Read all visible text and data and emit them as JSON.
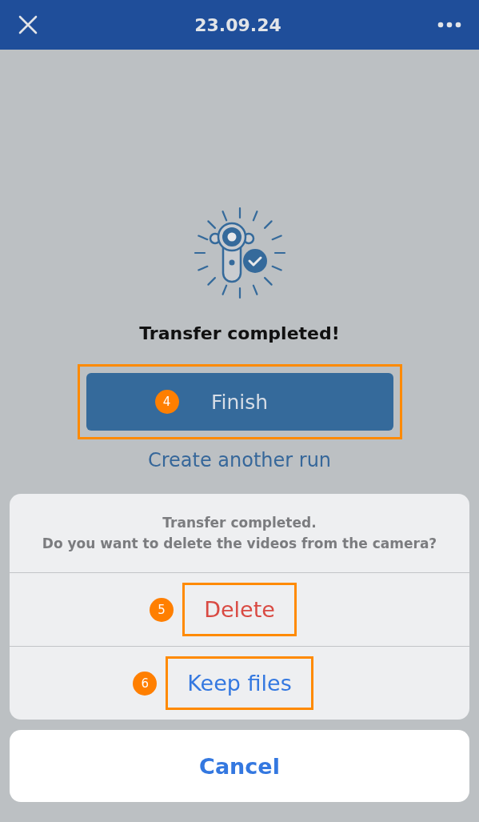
{
  "header": {
    "title": "23.09.24"
  },
  "status": {
    "title": "Transfer completed!"
  },
  "primary_button": {
    "label": "Finish",
    "callout": "4"
  },
  "link": {
    "label": "Create another run"
  },
  "action_sheet": {
    "message": [
      "Transfer completed.",
      "Do you want to delete the videos from the camera?"
    ],
    "actions": [
      {
        "label": "Delete",
        "kind": "destructive",
        "callout": "5"
      },
      {
        "label": "Keep files",
        "kind": "default",
        "callout": "6"
      }
    ]
  },
  "cancel": {
    "label": "Cancel"
  }
}
